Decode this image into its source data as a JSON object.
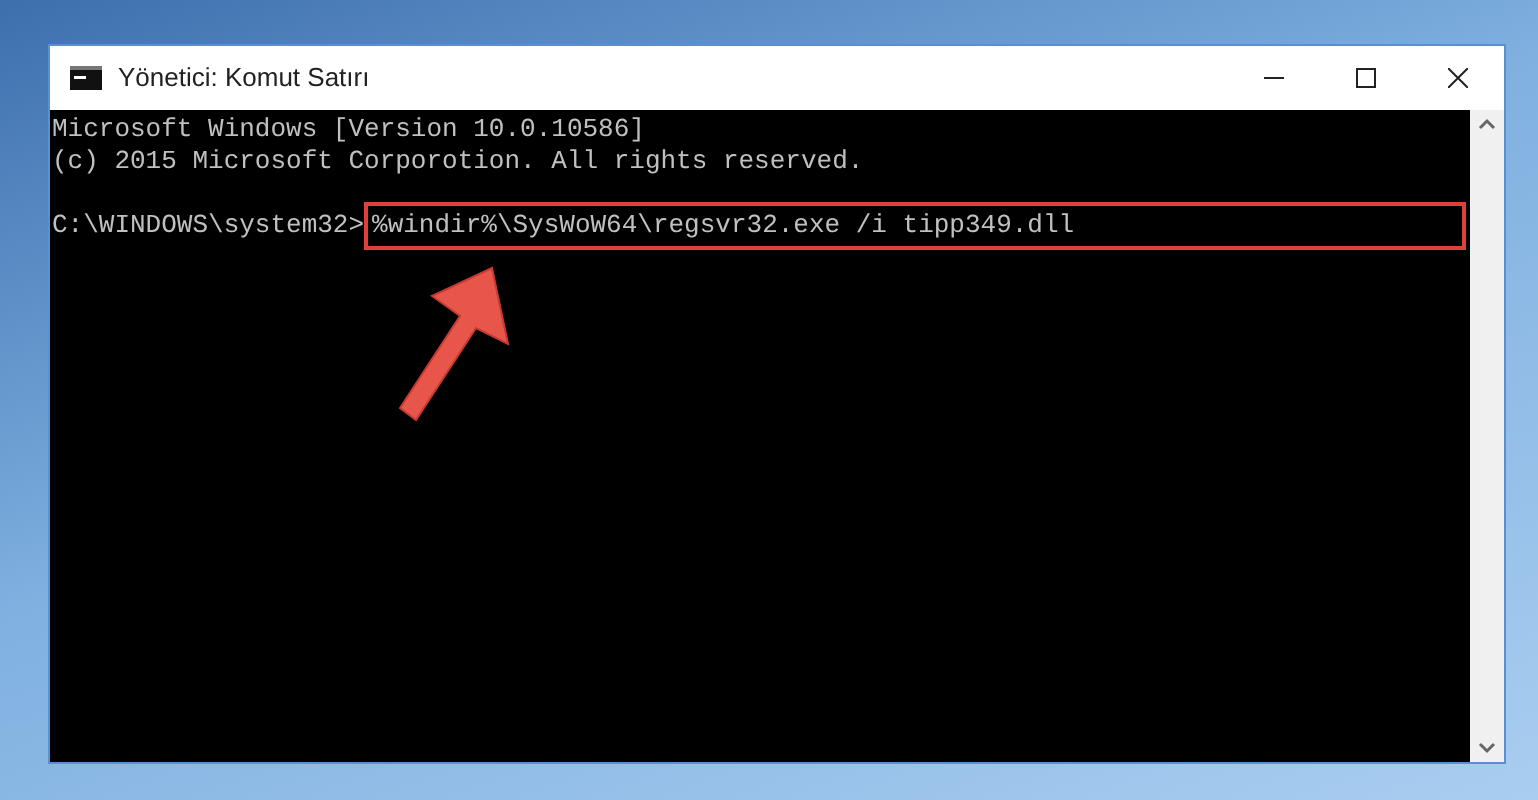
{
  "window": {
    "title": "Yönetici: Komut Satırı"
  },
  "console": {
    "lines": [
      "Microsoft Windows [Version 10.0.10586]",
      "(c) 2015 Microsoft Corporotion. All rights reserved."
    ],
    "prompt": "C:\\WINDOWS\\system32>",
    "command": "%windir%\\SysWoW64\\regsvr32.exe /i tipp349.dll",
    "command_highlighted": true
  }
}
